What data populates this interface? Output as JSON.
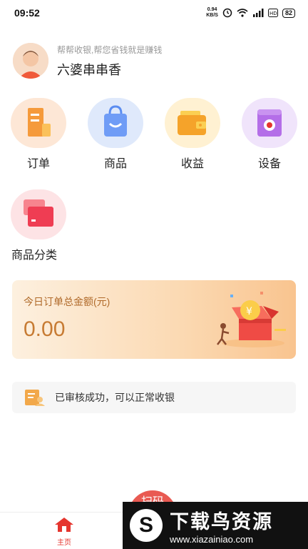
{
  "status": {
    "time": "09:52",
    "net_top": "0.94",
    "net_bottom": "KB/S",
    "signal_text": "4G",
    "battery": "82"
  },
  "profile": {
    "slogan": "帮帮收银,帮您省钱就是赚钱",
    "shop_name": "六婆串串香"
  },
  "menu": {
    "items": [
      {
        "label": "订单",
        "icon": "order-icon",
        "bg": "#fde7d6"
      },
      {
        "label": "商品",
        "icon": "shopping-bag-icon",
        "bg": "#dfe9fb"
      },
      {
        "label": "收益",
        "icon": "wallet-icon",
        "bg": "#fff1d2"
      },
      {
        "label": "设备",
        "icon": "device-icon",
        "bg": "#f0e4fb"
      },
      {
        "label": "商品分类",
        "icon": "category-icon",
        "bg": "#fde3e5"
      }
    ]
  },
  "card": {
    "title": "今日订单总金额(元)",
    "amount": "0.00"
  },
  "notice": {
    "text": "已审核成功，可以正常收银"
  },
  "nav": {
    "home_label": "主页",
    "fab_label": "扫码"
  },
  "watermark": {
    "logo": "S",
    "title": "下载鸟资源",
    "url": "www.xiazainiao.com"
  },
  "colors": {
    "accent": "#e5352e",
    "gold": "#c77b33"
  }
}
